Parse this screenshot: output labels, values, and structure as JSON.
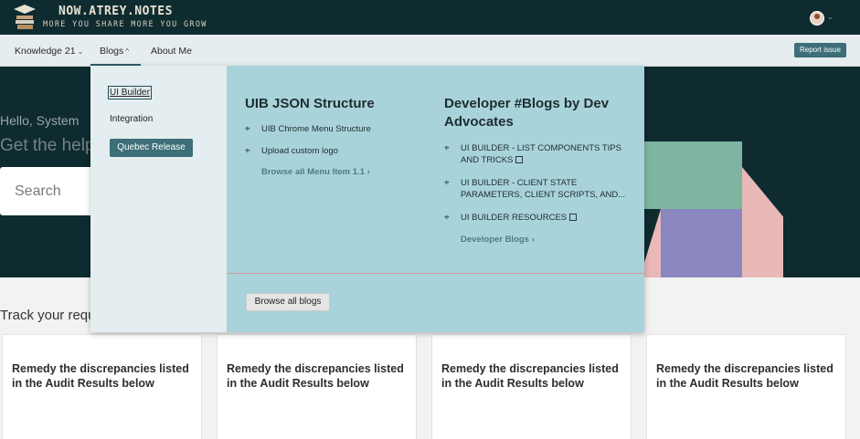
{
  "header": {
    "brand": "NOW.ATREY.NOTES",
    "tagline": "MORE YOU SHARE MORE YOU GROW",
    "logo_icon": "books-stack-icon",
    "avatar_icon": "user-avatar-icon"
  },
  "nav": {
    "items": [
      {
        "label": "Knowledge 21",
        "chevron": "⌄"
      },
      {
        "label": "Blogs",
        "chevron": "^"
      },
      {
        "label": "About Me",
        "chevron": ""
      }
    ],
    "report_issue": "Report issue"
  },
  "hero": {
    "greeting": "Hello, System",
    "title": "Get the help",
    "search_placeholder": "Search"
  },
  "track_title": "Track your requ",
  "cards": [
    "Remedy the discrepancies listed in the Audit Results below",
    "Remedy the discrepancies listed in the Audit Results below",
    "Remedy the discrepancies listed in the Audit Results below",
    "Remedy the discrepancies listed in the Audit Results below"
  ],
  "menu": {
    "left": {
      "ui_builder": "UI Builder",
      "integration": "Integration",
      "quebec_release": "Quebec Release"
    },
    "col1": {
      "title": "UIB JSON Structure",
      "items": [
        "UIB Chrome Menu Structure",
        "Upload custom logo"
      ],
      "browse": "Browse all Menu Item 1.1"
    },
    "col2": {
      "title_line1": "Developer #Blogs by Dev",
      "title_line2": "Advocates",
      "items": [
        {
          "line1": "UI BUILDER - LIST COMPONENTS TIPS",
          "line2": "AND TRICKS"
        },
        {
          "line1": "UI BUILDER - CLIENT STATE",
          "line2": "PARAMETERS, CLIENT SCRIPTS, AND..."
        },
        {
          "line1": "UI BUILDER RESOURCES",
          "line2": ""
        }
      ],
      "browse": "Developer Blogs"
    },
    "browse_all_blogs": "Browse all blogs"
  },
  "colors": {
    "header_bg": "#0e2b30",
    "menu_right_bg": "#a9d3db",
    "menu_left_bg": "#e4edef",
    "accent_button": "#3d6f78"
  }
}
